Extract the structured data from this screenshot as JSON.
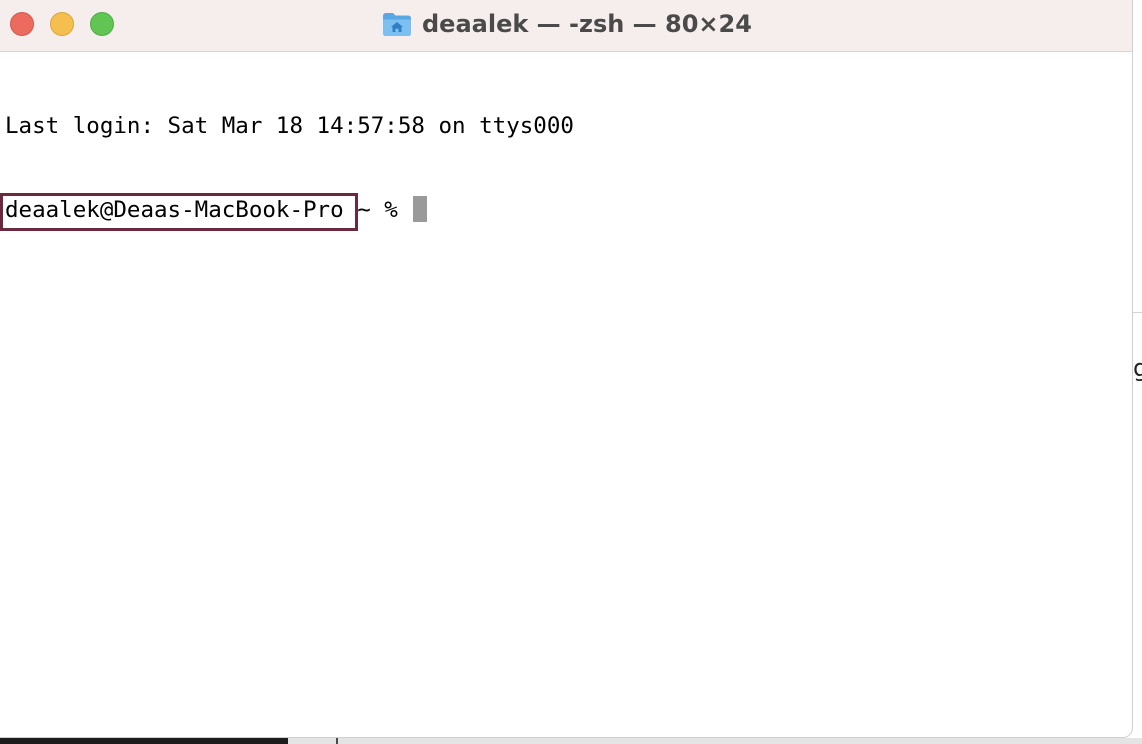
{
  "window": {
    "title": "deaalek — -zsh — 80×24",
    "title_icon": "home-folder-icon"
  },
  "terminal": {
    "last_login": "Last login: Sat Mar 18 14:57:58 on ttys000",
    "prompt_user_host": "deaalek@Deaas-MacBook-Pro",
    "prompt_suffix": " ~ % "
  },
  "background": {
    "peek_glyph": "g"
  },
  "colors": {
    "titlebar": "#f5eeec",
    "close": "#ec6a5e",
    "minimize": "#f4bf4f",
    "maximize": "#61c554",
    "highlight_box": "#6a2a3e",
    "cursor": "#9a9a9a"
  }
}
